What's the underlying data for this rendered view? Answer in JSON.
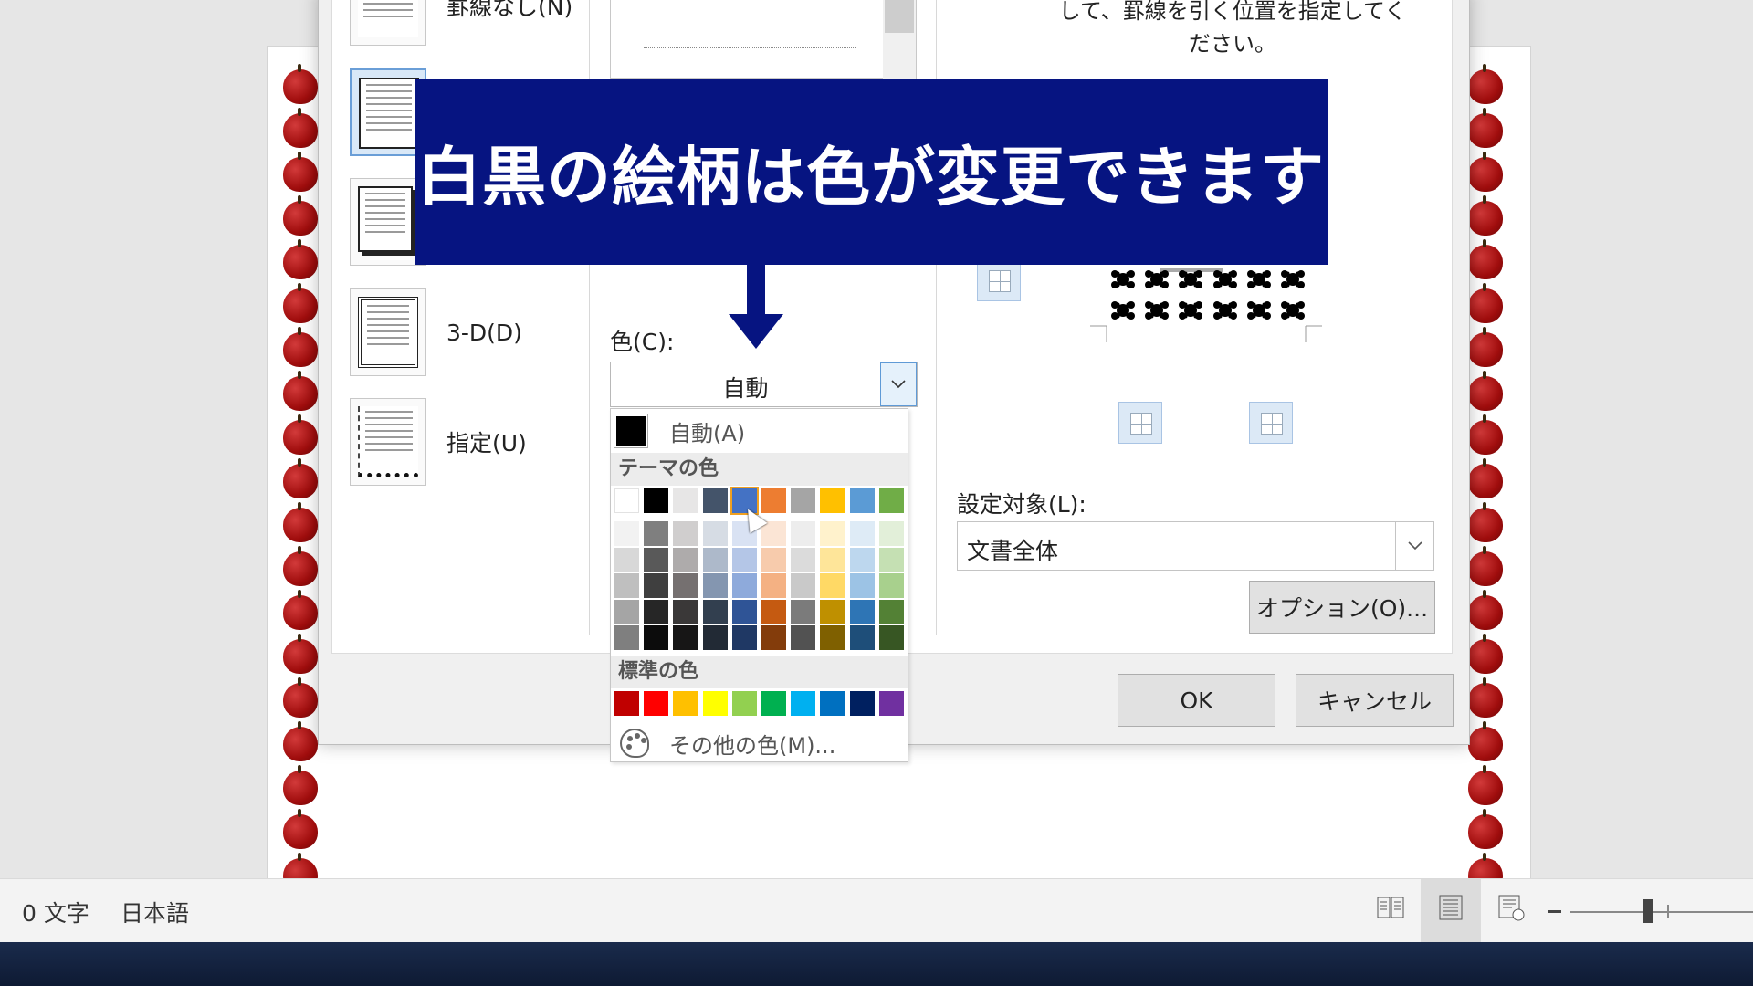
{
  "dialog": {
    "settings": [
      {
        "label": "罫線なし(N)",
        "mnemonic": "N",
        "kind": "none"
      },
      {
        "label": "",
        "kind": "box"
      },
      {
        "label": "",
        "kind": "shadow"
      },
      {
        "label": "3-D(D)",
        "mnemonic": "D",
        "kind": "threed"
      },
      {
        "label": "指定(U)",
        "mnemonic": "U",
        "kind": "custom"
      }
    ],
    "color_label": "色(C):",
    "color_value": "自動",
    "color_popup": {
      "auto_label": "自動(A)",
      "theme_title": "テーマの色",
      "standard_title": "標準の色",
      "more_label": "その他の色(M)...",
      "theme_top": [
        "#ffffff",
        "#000000",
        "#e7e6e6",
        "#44546a",
        "#4472c4",
        "#ed7d31",
        "#a5a5a5",
        "#ffc000",
        "#5b9bd5",
        "#70ad47"
      ],
      "theme_shades": [
        [
          "#f2f2f2",
          "#7f7f7f",
          "#d0cece",
          "#d6dce4",
          "#d9e2f3",
          "#fbe5d5",
          "#ededed",
          "#fff2cc",
          "#deebf6",
          "#e2efd9"
        ],
        [
          "#d8d8d8",
          "#595959",
          "#aeabab",
          "#adb9ca",
          "#b4c6e7",
          "#f7cbac",
          "#dbdbdb",
          "#fee599",
          "#bdd7ee",
          "#c5e0b3"
        ],
        [
          "#bfbfbf",
          "#3f3f3f",
          "#757070",
          "#8496b0",
          "#8eaadb",
          "#f4b183",
          "#c9c9c9",
          "#ffd965",
          "#9cc3e5",
          "#a8d08d"
        ],
        [
          "#a5a5a5",
          "#262626",
          "#3a3838",
          "#323f4f",
          "#2f5496",
          "#c55a11",
          "#7b7b7b",
          "#bf9000",
          "#2e75b5",
          "#538135"
        ],
        [
          "#7f7f7f",
          "#0c0c0c",
          "#171616",
          "#222a35",
          "#1f3864",
          "#833c0b",
          "#525252",
          "#7f6000",
          "#1e4e79",
          "#375623"
        ]
      ],
      "standard": [
        "#c00000",
        "#ff0000",
        "#ffc000",
        "#ffff00",
        "#92d050",
        "#00b050",
        "#00b0f0",
        "#0070c0",
        "#002060",
        "#7030a0"
      ],
      "highlight_index": 4
    },
    "instruction": "して、罫線を引く位置を指定してく\nださい。",
    "apply_label": "設定対象(L):",
    "apply_value": "文書全体",
    "options_button": "オプション(O)...",
    "ok_button": "OK",
    "cancel_button": "キャンセル"
  },
  "banner": {
    "text": "白黒の絵柄は色が変更できます",
    "color": "#061481"
  },
  "statusbar": {
    "word_count": "0 文字",
    "language": "日本語"
  }
}
